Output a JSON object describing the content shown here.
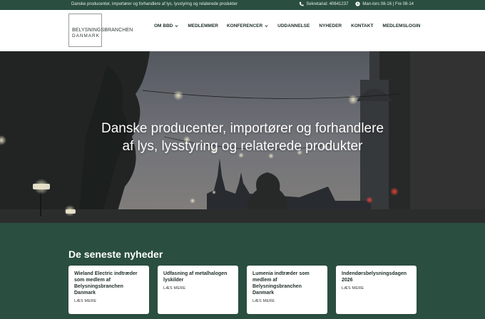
{
  "topbar": {
    "tagline": "Danske producenter, importører og forhandlere af lys, lysstyring og relaterede produkter",
    "phone_icon": "phone-icon",
    "phone": "Sekretariat: 40641237",
    "clock_icon": "clock-icon",
    "hours": "Man-tors 08-16 | Fre 08-14"
  },
  "logo": {
    "line1": "BELYSNINGSBRANCHEN",
    "line2": "DANMARK"
  },
  "nav": {
    "items": [
      {
        "label": "OM BBD",
        "dropdown": true
      },
      {
        "label": "MEDLEMMER",
        "dropdown": false
      },
      {
        "label": "KONFERENCER",
        "dropdown": true
      },
      {
        "label": "UDDANNELSE",
        "dropdown": false
      },
      {
        "label": "NYHEDER",
        "dropdown": false
      },
      {
        "label": "KONTAKT",
        "dropdown": false
      },
      {
        "label": "MEDLEMSLOGIN",
        "dropdown": false
      }
    ]
  },
  "hero": {
    "line1": "Danske producenter, importører og forhandlere",
    "line2": "af lys, lysstyring og relaterede produkter"
  },
  "news": {
    "heading": "De seneste nyheder",
    "cards": [
      {
        "title": "Wieland Electric indtræder som medlem af Belysningsbranchen Danmark",
        "link": "LÆS MERE"
      },
      {
        "title": "Udfasning af metalhalogen lyskilder",
        "link": "LÆS MERE"
      },
      {
        "title": "Lumenia indtræder som medlem af Belysningsbranchen Danmark",
        "link": "LÆS MERE"
      },
      {
        "title": "Indendørsbelysningsdagen 2026",
        "link": "LÆS MERE"
      }
    ]
  },
  "colors": {
    "brand_green": "#2a4e40",
    "header_bg": "#ffffff",
    "text_dark": "#1f2e29"
  }
}
